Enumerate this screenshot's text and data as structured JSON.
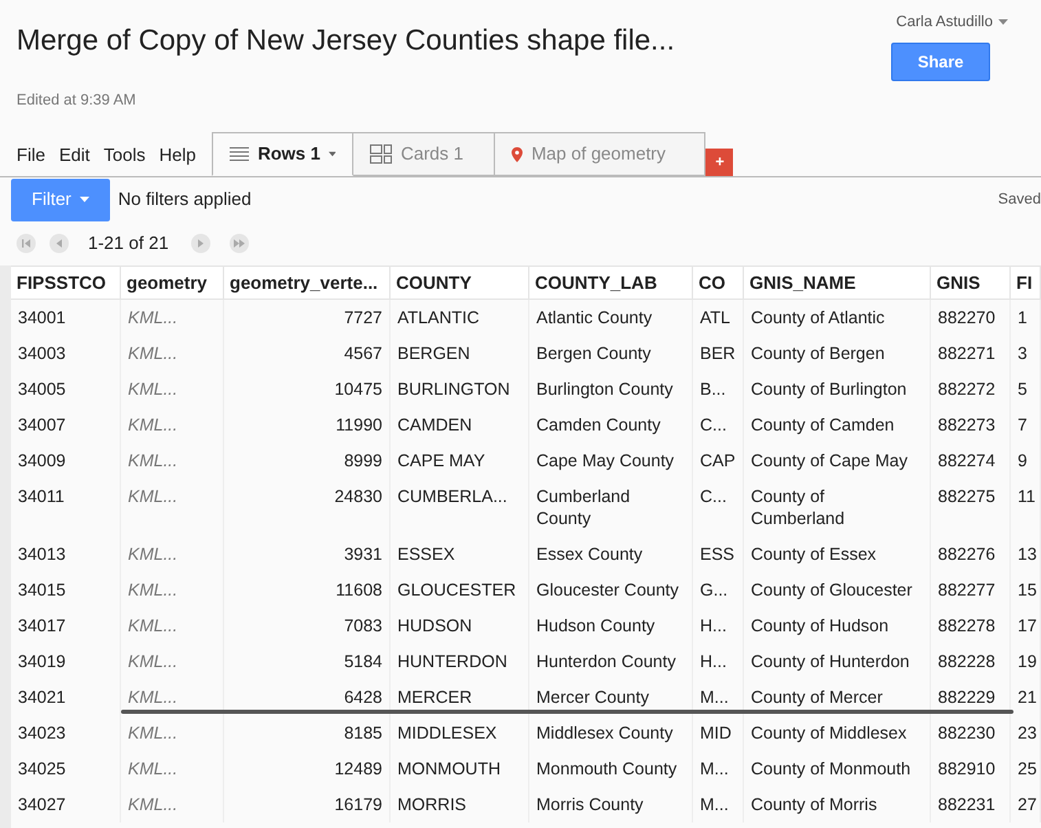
{
  "title": "Merge of Copy of New Jersey Counties shape file...",
  "user": "Carla Astudillo",
  "share_button": "Share",
  "edited": "Edited at 9:39 AM",
  "menu": [
    "File",
    "Edit",
    "Tools",
    "Help"
  ],
  "tabs": [
    {
      "label": "Rows 1",
      "kind": "rows",
      "selected": true
    },
    {
      "label": "Cards 1",
      "kind": "cards",
      "selected": false
    },
    {
      "label": "Map of geometry",
      "kind": "map",
      "selected": false
    }
  ],
  "add_tab": "+",
  "filter_button": "Filter",
  "filter_status": "No filters applied",
  "save_status": "Saved",
  "pagination": "1-21 of 21",
  "table": {
    "columns": [
      {
        "label": "FIPSSTCO",
        "kind": "text"
      },
      {
        "label": "geometry",
        "kind": "geometry"
      },
      {
        "label": "geometry_verte...",
        "kind": "number"
      },
      {
        "label": "COUNTY",
        "kind": "text"
      },
      {
        "label": "COUNTY_LAB",
        "kind": "text"
      },
      {
        "label": "CO",
        "kind": "text"
      },
      {
        "label": "GNIS_NAME",
        "kind": "text"
      },
      {
        "label": "GNIS",
        "kind": "text"
      },
      {
        "label": "FI",
        "kind": "text"
      }
    ],
    "rows": [
      {
        "cells": [
          "34001",
          "KML...",
          "7727",
          "ATLANTIC",
          "Atlantic County",
          "ATL",
          "County of Atlantic",
          "882270",
          "1"
        ],
        "struck": false
      },
      {
        "cells": [
          "34003",
          "KML...",
          "4567",
          "BERGEN",
          "Bergen County",
          "BER",
          "County of Bergen",
          "882271",
          "3"
        ],
        "struck": false
      },
      {
        "cells": [
          "34005",
          "KML...",
          "10475",
          "BURLINGTON",
          "Burlington County",
          "B...",
          "County of Burlington",
          "882272",
          "5"
        ],
        "struck": false
      },
      {
        "cells": [
          "34007",
          "KML...",
          "11990",
          "CAMDEN",
          "Camden County",
          "C...",
          "County of Camden",
          "882273",
          "7"
        ],
        "struck": false
      },
      {
        "cells": [
          "34009",
          "KML...",
          "8999",
          "CAPE MAY",
          "Cape May County",
          "CAP",
          "County of Cape May",
          "882274",
          "9"
        ],
        "struck": false
      },
      {
        "cells": [
          "34011",
          "KML...",
          "24830",
          "CUMBERLA...",
          "Cumberland County",
          "C...",
          "County of Cumberland",
          "882275",
          "11"
        ],
        "struck": false
      },
      {
        "cells": [
          "34013",
          "KML...",
          "3931",
          "ESSEX",
          "Essex County",
          "ESS",
          "County of Essex",
          "882276",
          "13"
        ],
        "struck": false
      },
      {
        "cells": [
          "34015",
          "KML...",
          "11608",
          "GLOUCESTER",
          "Gloucester County",
          "G...",
          "County of Gloucester",
          "882277",
          "15"
        ],
        "struck": false
      },
      {
        "cells": [
          "34017",
          "KML...",
          "7083",
          "HUDSON",
          "Hudson County",
          "H...",
          "County of Hudson",
          "882278",
          "17"
        ],
        "struck": false
      },
      {
        "cells": [
          "34019",
          "KML...",
          "5184",
          "HUNTERDON",
          "Hunterdon County",
          "H...",
          "County of Hunterdon",
          "882228",
          "19"
        ],
        "struck": false
      },
      {
        "cells": [
          "34021",
          "KML...",
          "6428",
          "MERCER",
          "Mercer County",
          "M...",
          "County of Mercer",
          "882229",
          "21"
        ],
        "struck": true
      },
      {
        "cells": [
          "34023",
          "KML...",
          "8185",
          "MIDDLESEX",
          "Middlesex County",
          "MID",
          "County of Middlesex",
          "882230",
          "23"
        ],
        "struck": false
      },
      {
        "cells": [
          "34025",
          "KML...",
          "12489",
          "MONMOUTH",
          "Monmouth County",
          "M...",
          "County of Monmouth",
          "882910",
          "25"
        ],
        "struck": false
      },
      {
        "cells": [
          "34027",
          "KML...",
          "16179",
          "MORRIS",
          "Morris County",
          "M...",
          "County of Morris",
          "882231",
          "27"
        ],
        "struck": false
      }
    ]
  }
}
